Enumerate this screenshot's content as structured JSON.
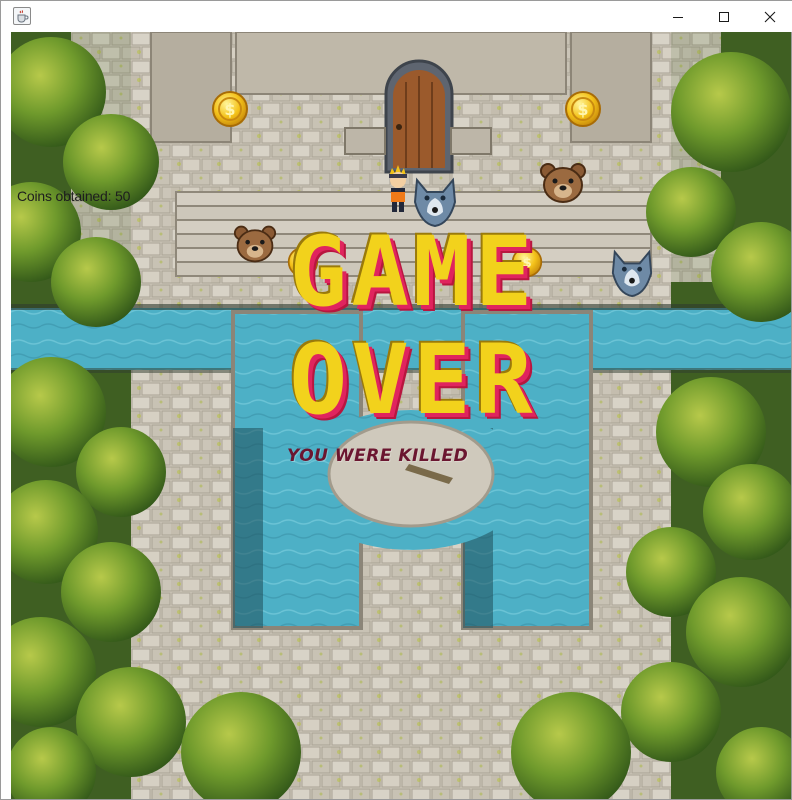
{
  "window": {
    "title": "",
    "icon": "java-cup-icon",
    "controls": [
      "minimize-icon",
      "maximize-icon",
      "close-icon"
    ]
  },
  "hud": {
    "score_text": "Coins obtained: 50"
  },
  "game_over": {
    "line1": "GAME",
    "line2": "OVER",
    "subtitle": "YOU WERE KILLED"
  },
  "sprites": {
    "player": "ninja-player-icon",
    "enemies": [
      "wolf-icon",
      "wolf-icon",
      "bear-icon",
      "bear-icon"
    ],
    "coins": [
      "coin-icon",
      "coin-icon",
      "coin-icon",
      "coin-icon"
    ]
  },
  "colors": {
    "title_yellow": "#f2d21c",
    "title_shadow": "#e0245e",
    "subtitle": "#6b1630",
    "water": "#4fb3c8",
    "foliage": "#4f7a22",
    "stone": "#c9c3b6"
  }
}
